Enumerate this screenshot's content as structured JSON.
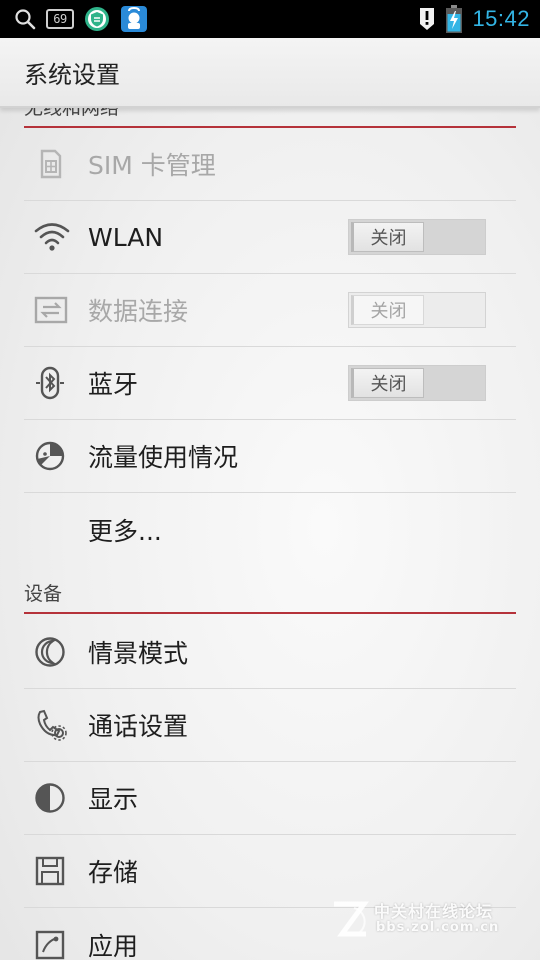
{
  "status_bar": {
    "notification_count": "69",
    "time": "15:42",
    "icons": [
      "search-icon",
      "notification-count-icon",
      "security-shield-icon",
      "app-store-icon",
      "alert-icon",
      "battery-charging-icon"
    ]
  },
  "action_bar": {
    "title": "系统设置"
  },
  "sections": {
    "wireless": {
      "header": "无线和网络"
    },
    "device": {
      "header": "设备"
    }
  },
  "items": {
    "sim": {
      "label": "SIM 卡管理",
      "icon": "sim-card-icon",
      "enabled": false
    },
    "wlan": {
      "label": "WLAN",
      "icon": "wifi-icon",
      "toggle": "关闭"
    },
    "data": {
      "label": "数据连接",
      "icon": "data-transfer-icon",
      "toggle": "关闭",
      "enabled": false
    },
    "bluetooth": {
      "label": "蓝牙",
      "icon": "bluetooth-icon",
      "toggle": "关闭"
    },
    "data_usage": {
      "label": "流量使用情况",
      "icon": "data-usage-icon"
    },
    "more": {
      "label": "更多..."
    },
    "profiles": {
      "label": "情景模式",
      "icon": "profile-moon-icon"
    },
    "call": {
      "label": "通话设置",
      "icon": "call-settings-icon"
    },
    "display": {
      "label": "显示",
      "icon": "display-icon"
    },
    "storage": {
      "label": "存储",
      "icon": "storage-icon"
    },
    "apps": {
      "label": "应用",
      "icon": "apps-icon"
    }
  },
  "watermark": {
    "name": "中关村在线论坛",
    "url": "bbs.zol.com.cn"
  },
  "colors": {
    "accent_divider": "#b5323a",
    "clock": "#33b5e5",
    "toggle_track": "#d5d5d5"
  }
}
